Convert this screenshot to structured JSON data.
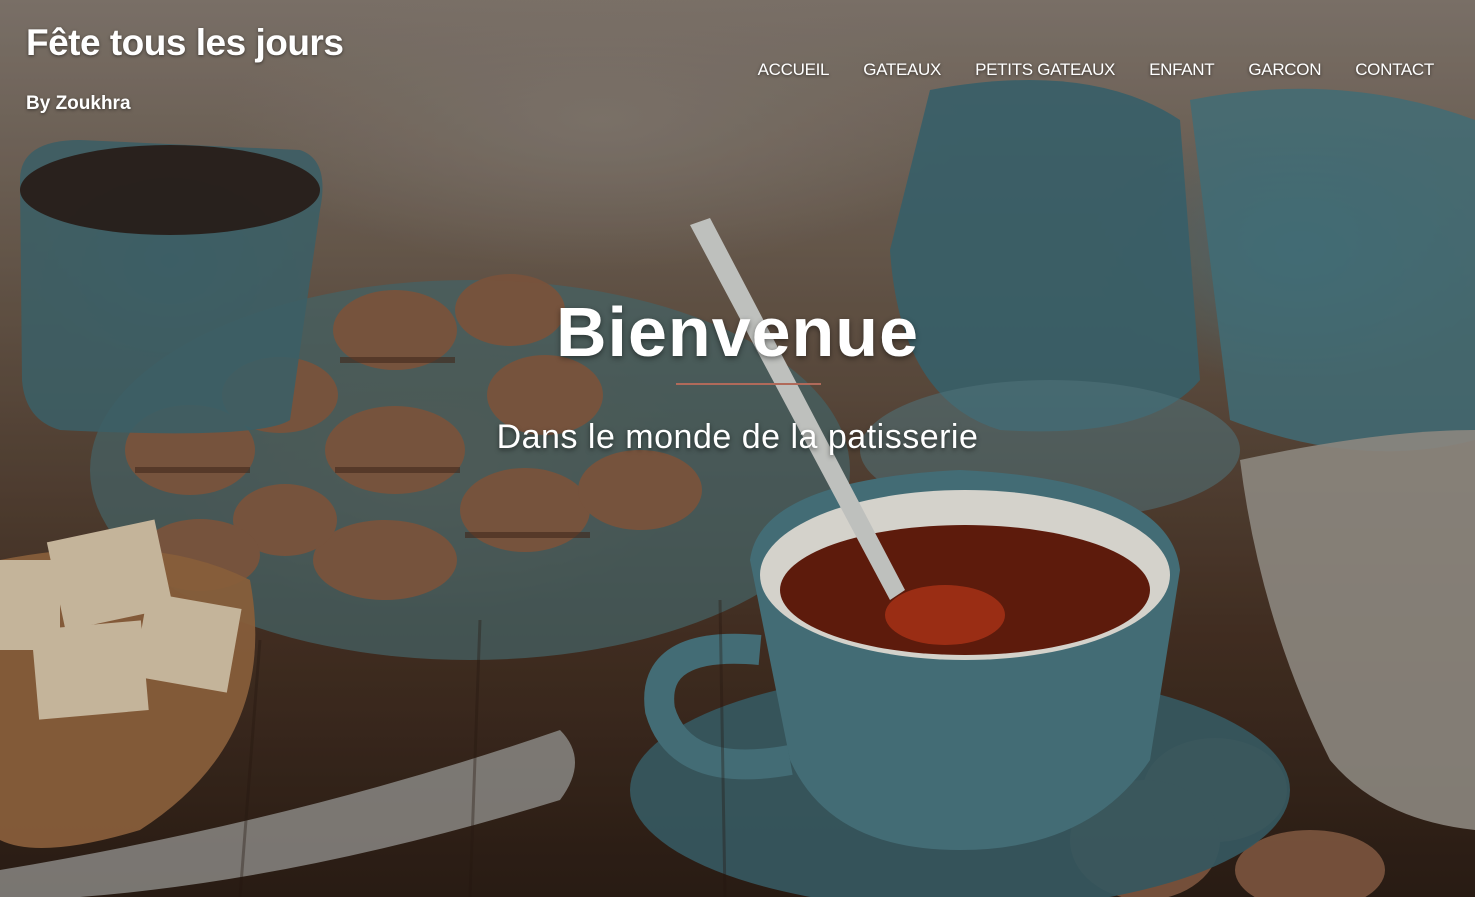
{
  "site": {
    "title": "Fête tous les jours",
    "tagline": "By Zoukhra"
  },
  "nav": {
    "items": [
      {
        "label": "ACCUEIL"
      },
      {
        "label": "GATEAUX"
      },
      {
        "label": "PETITS GATEAUX"
      },
      {
        "label": "ENFANT"
      },
      {
        "label": "GARCON"
      },
      {
        "label": "CONTACT"
      }
    ]
  },
  "hero": {
    "title": "Bienvenue",
    "subtitle": "Dans le monde de la patisserie",
    "divider_color": "#b06a5a",
    "background_image": "tea-cup-macarons-photo"
  }
}
